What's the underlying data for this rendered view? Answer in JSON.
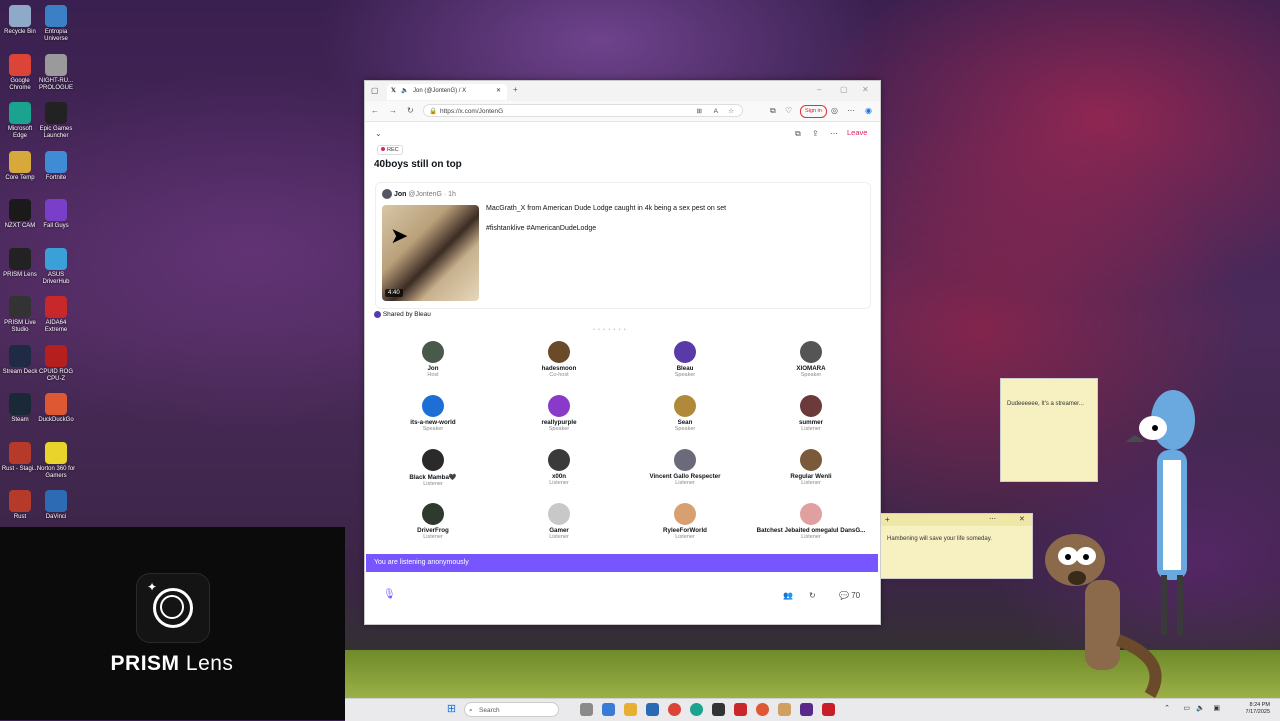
{
  "desktop": {
    "icons": [
      {
        "label": "Recycle Bin",
        "color": "#8fa9c9"
      },
      {
        "label": "Entropia Universe",
        "color": "#3b7fc4"
      },
      {
        "label": "Google Chrome",
        "color": "#db4437"
      },
      {
        "label": "NIGHT-RU... PROLOGUE",
        "color": "#9a9a9a"
      },
      {
        "label": "Microsoft Edge",
        "color": "#1aa38f"
      },
      {
        "label": "Epic Games Launcher",
        "color": "#222222"
      },
      {
        "label": "Core Temp",
        "color": "#d6a93a"
      },
      {
        "label": "Fortnite",
        "color": "#3f8bd6"
      },
      {
        "label": "NZXT CAM",
        "color": "#1a1a1a"
      },
      {
        "label": "Fall Guys",
        "color": "#7a3fc8"
      },
      {
        "label": "PRISM Lens",
        "color": "#222222"
      },
      {
        "label": "ASUS DriverHub",
        "color": "#3aa0d8"
      },
      {
        "label": "PRISM Live Studio",
        "color": "#333333"
      },
      {
        "label": "AIDA64 Extreme",
        "color": "#c8282a"
      },
      {
        "label": "Stream Deck",
        "color": "#1f2a44"
      },
      {
        "label": "CPUID ROG CPU-Z",
        "color": "#b5201f"
      },
      {
        "label": "Steam",
        "color": "#1b2838"
      },
      {
        "label": "DuckDuckGo",
        "color": "#de5833"
      },
      {
        "label": "Rust - Stagi...",
        "color": "#b63a2a"
      },
      {
        "label": "Norton 360 for Gamers",
        "color": "#e8d42a"
      },
      {
        "label": "Rust",
        "color": "#b63a2a"
      },
      {
        "label": "DaVinci",
        "color": "#2d6bb5"
      }
    ]
  },
  "prism": {
    "title_bold": "PRISM",
    "title_rest": " Lens"
  },
  "browser": {
    "tab_title": "Jon (@JontenG) / X",
    "url": "https://x.com/JontenG",
    "signin": "Sign in"
  },
  "space": {
    "leave_label": "Leave",
    "rec_label": "REC",
    "title": "40boys still on top",
    "post": {
      "author": "Jon",
      "handle": "@JontenG · 1h",
      "text": "MacGrath_X from American Dude Lodge caught in 4k being a sex pest on set",
      "hashtags": "#fishtanklive #AmericanDudeLodge",
      "duration": "4:40"
    },
    "shared_by": "Shared by Bleau",
    "participants": [
      {
        "name": "Jon",
        "role": "Host",
        "color": "#4a5a4a"
      },
      {
        "name": "hadesmoon",
        "role": "Co-host",
        "color": "#6b4a2a"
      },
      {
        "name": "Bleau",
        "role": "Speaker",
        "color": "#5a3aa8"
      },
      {
        "name": "XIOMARA",
        "role": "Speaker",
        "color": "#555555"
      },
      {
        "name": "its-a-new-world",
        "role": "Speaker",
        "color": "#1d6fd6"
      },
      {
        "name": "reallypurple",
        "role": "Speaker",
        "color": "#8a3ac8"
      },
      {
        "name": "Sean",
        "role": "Speaker",
        "color": "#b08a3a"
      },
      {
        "name": "summer",
        "role": "Listener",
        "color": "#6b3a3a"
      },
      {
        "name": "Black Mamba🖤",
        "role": "Listener",
        "color": "#2a2a2a"
      },
      {
        "name": "x00n",
        "role": "Listener",
        "color": "#3a3a3a"
      },
      {
        "name": "Vincent Gallo Respecter",
        "role": "Listener",
        "color": "#6a6a7a"
      },
      {
        "name": "Regular Wenli",
        "role": "Listener",
        "color": "#7a5a3a"
      },
      {
        "name": "DriverFrog",
        "role": "Listener",
        "color": "#2f3a2f"
      },
      {
        "name": "Gamer",
        "role": "Listener",
        "color": "#c8c8c8"
      },
      {
        "name": "RyleeForWorld",
        "role": "Listener",
        "color": "#d8a070"
      },
      {
        "name": "Batchest Jebaited omegalul DansG...",
        "role": "Listener",
        "color": "#e0a0a0"
      }
    ],
    "listening_banner": "You are listening anonymously",
    "reply_count": "70"
  },
  "notes": {
    "note1": "Dudeeeeee, It's a streamer...",
    "note2": "Hambening will save your life someday."
  },
  "taskbar": {
    "search_placeholder": "Search",
    "time": "8:24 PM",
    "date": "7/17/2025"
  }
}
